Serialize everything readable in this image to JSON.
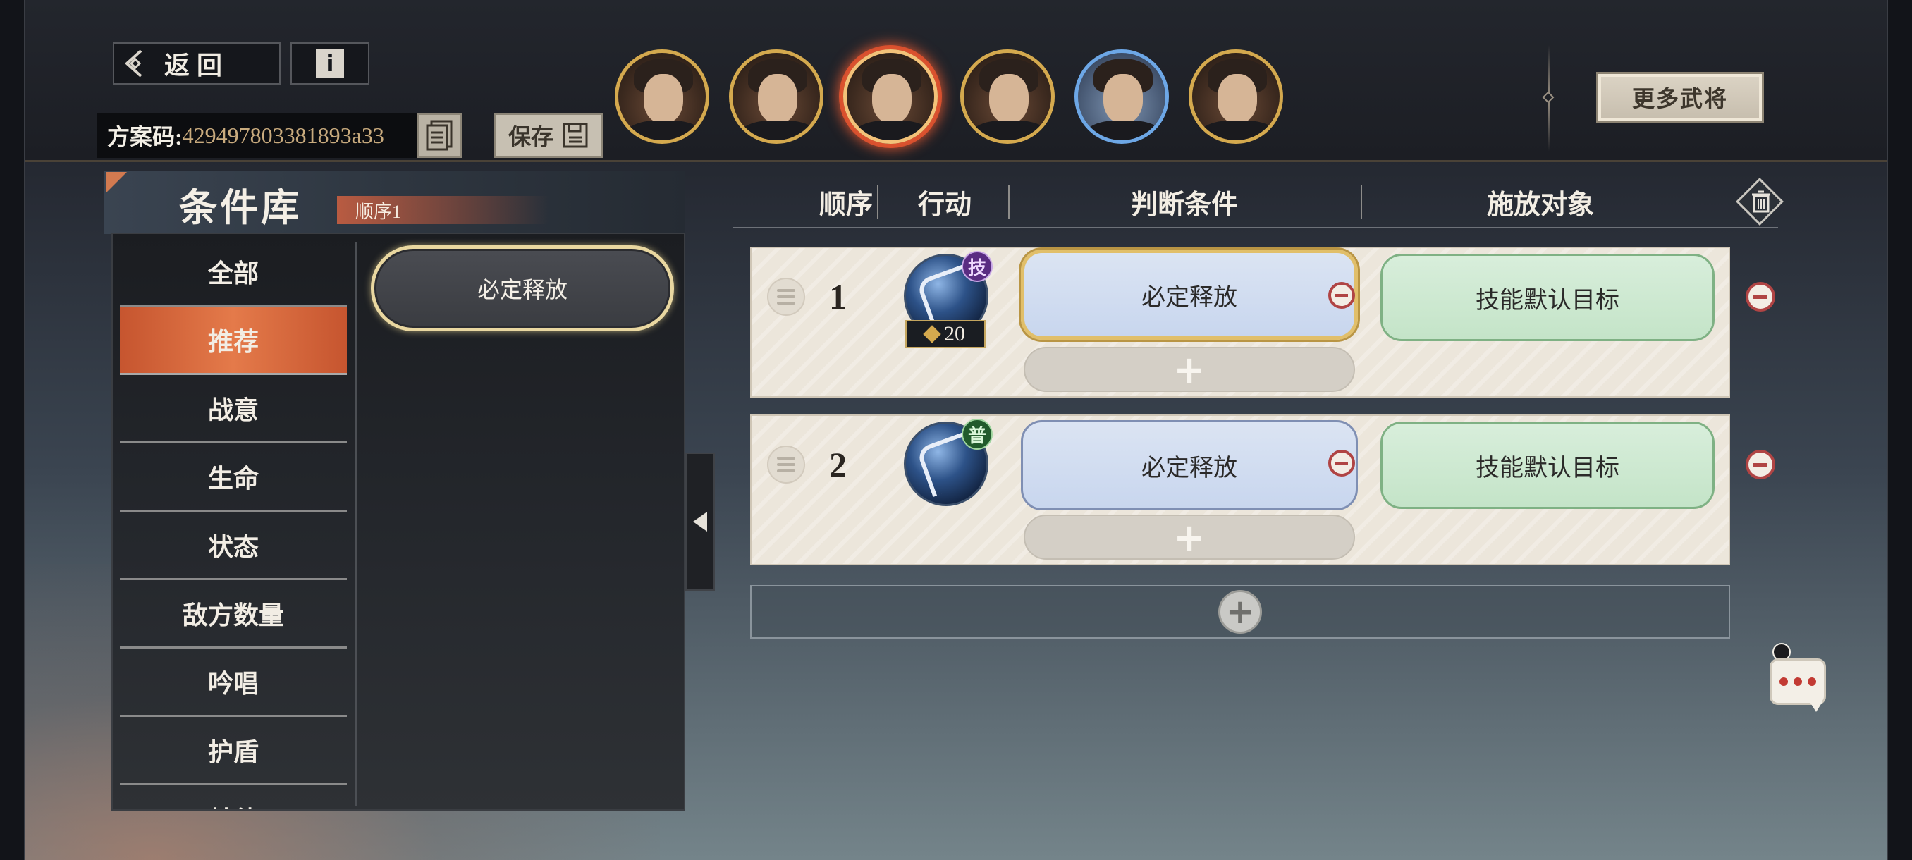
{
  "nav": {
    "back_label": "返回",
    "back_icon": "chevron-left-icon",
    "info_icon": "info-icon",
    "info_glyph": "i"
  },
  "plan": {
    "code_label": "方案码:",
    "code_value": "429497803381893a33",
    "copy_icon": "document-copy-icon",
    "save_label": "保存",
    "save_icon": "save-disk-icon"
  },
  "generals": {
    "portraits": [
      {
        "name": "general-portrait-1",
        "selected": false,
        "frame": "gold"
      },
      {
        "name": "general-portrait-2",
        "selected": false,
        "frame": "gold"
      },
      {
        "name": "general-portrait-3",
        "selected": true,
        "frame": "gold"
      },
      {
        "name": "general-portrait-4",
        "selected": false,
        "frame": "gold"
      },
      {
        "name": "general-portrait-5",
        "selected": false,
        "frame": "blue"
      },
      {
        "name": "general-portrait-6",
        "selected": false,
        "frame": "gold"
      }
    ],
    "more_label": "更多武将"
  },
  "library": {
    "title": "条件库",
    "order_tag": "顺序1",
    "categories": [
      {
        "label": "全部",
        "active": false
      },
      {
        "label": "推荐",
        "active": true
      },
      {
        "label": "战意",
        "active": false
      },
      {
        "label": "生命",
        "active": false
      },
      {
        "label": "状态",
        "active": false
      },
      {
        "label": "敌方数量",
        "active": false
      },
      {
        "label": "吟唱",
        "active": false
      },
      {
        "label": "护盾",
        "active": false
      },
      {
        "label": "其他",
        "active": false
      }
    ],
    "conditions": [
      {
        "label": "必定释放"
      }
    ],
    "collapse_icon": "triangle-left-icon"
  },
  "table": {
    "headers": {
      "order": "顺序",
      "action": "行动",
      "condition": "判断条件",
      "target": "施放对象"
    },
    "delete_all_icon": "trash-icon",
    "rows": [
      {
        "order": "1",
        "skill_icon": "spear-skill-icon",
        "badge": "技",
        "badge_color": "#5a2c82",
        "cost": "20",
        "condition": "必定释放",
        "target": "技能默认目标",
        "condition_selected": true
      },
      {
        "order": "2",
        "skill_icon": "spear-skill-icon",
        "badge": "普",
        "badge_color": "#215a2c",
        "cost": "",
        "condition": "必定释放",
        "target": "技能默认目标",
        "condition_selected": false
      }
    ],
    "add_condition_glyph": "+",
    "add_row_glyph": "+"
  },
  "chat": {
    "icon": "chat-bubble-icon"
  },
  "colors": {
    "accent_orange": "#d9683c",
    "gold_frame": "#d4a94e",
    "condition_blue": "#c8d6ee",
    "target_green": "#c4e4c8",
    "remove_red": "#b04444"
  }
}
